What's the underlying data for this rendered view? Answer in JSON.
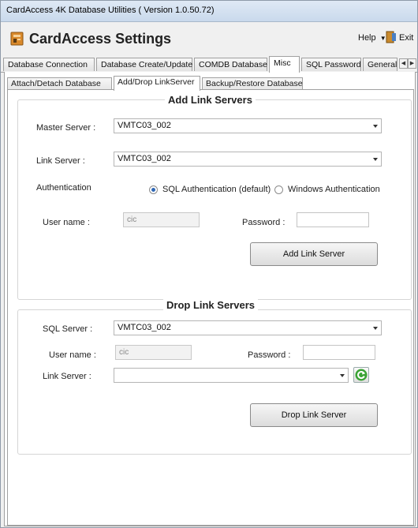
{
  "window": {
    "title": "CardAccess 4K Database Utilities ( Version 1.0.50.72)"
  },
  "header": {
    "app_title": "CardAccess Settings",
    "help_menu": "Help",
    "exit_menu": "Exit"
  },
  "main_tabs": [
    {
      "label": "Database Connection",
      "active": false
    },
    {
      "label": "Database Create/Update",
      "active": false
    },
    {
      "label": "COMDB Database",
      "active": false
    },
    {
      "label": "Misc",
      "active": true
    },
    {
      "label": "SQL Password",
      "active": false
    },
    {
      "label": "General",
      "active": false
    }
  ],
  "sub_tabs": [
    {
      "label": "Attach/Detach Database",
      "active": false
    },
    {
      "label": "Add/Drop LinkServer",
      "active": true
    },
    {
      "label": "Backup/Restore Database",
      "active": false
    }
  ],
  "add_link": {
    "title": "Add Link Servers",
    "master_server_label": "Master Server :",
    "master_server_value": "VMTC03_002",
    "link_server_label": "Link Server :",
    "link_server_value": "VMTC03_002",
    "auth_label": "Authentication",
    "auth_sql": "SQL Authentication (default)",
    "auth_windows": "Windows Authentication",
    "username_label": "User name :",
    "username_value": "cic",
    "password_label": "Password :",
    "password_value": "",
    "button": "Add Link Server"
  },
  "drop_link": {
    "title": "Drop Link Servers",
    "sql_server_label": "SQL Server :",
    "sql_server_value": "VMTC03_002",
    "username_label": "User name :",
    "username_value": "cic",
    "password_label": "Password :",
    "password_value": "",
    "link_server_label": "Link Server :",
    "link_server_value": "",
    "button": "Drop Link Server"
  },
  "colors": {
    "accent_blue": "#2f67b5",
    "refresh_green": "#3aa335"
  },
  "icons": [
    "app-icon",
    "help-dropdown-icon",
    "exit-icon",
    "tab-scroll-left-icon",
    "tab-scroll-right-icon",
    "chevron-down-icon",
    "refresh-icon"
  ]
}
